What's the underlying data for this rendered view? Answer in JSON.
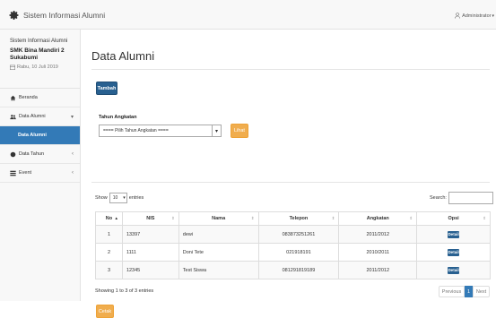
{
  "header": {
    "brand": "Sistem Informasi Alumni",
    "user": "Administrator"
  },
  "sidebar": {
    "app_name": "Sistem Informasi Alumni",
    "school": "SMK Bina Mandiri 2 Sukabumi",
    "date": "Rabu, 10 Juli 2019",
    "items": [
      {
        "label": "Beranda"
      },
      {
        "label": "Data Alumni"
      },
      {
        "label": "Data Alumni"
      },
      {
        "label": "Data Tahun"
      },
      {
        "label": "Event"
      }
    ]
  },
  "main": {
    "title": "Data Alumni",
    "add_button": "Tambah",
    "filter_label": "Tahun Angkatan",
    "filter_value": "==== Pilih Tahun Angkatan ====",
    "view_button": "Lihat",
    "show_label": "Show",
    "entries_value": "10",
    "entries_label": "entries",
    "search_label": "Search:",
    "table": {
      "columns": [
        "No",
        "NIS",
        "Nama",
        "Telepon",
        "Angkatan",
        "Opsi"
      ],
      "rows": [
        [
          "1",
          "13397",
          "dewi",
          "083873251261",
          "2011/2012",
          "Detail"
        ],
        [
          "2",
          "1111",
          "Doni Tete",
          "021918191",
          "2010/2011",
          "Detail"
        ],
        [
          "3",
          "12345",
          "Test Siswa",
          "081291819189",
          "2011/2012",
          "Detail"
        ]
      ]
    },
    "info": "Showing 1 to 3 of 3 entries",
    "pager": {
      "prev": "Previous",
      "page": "1",
      "next": "Next"
    },
    "print_button": "Cetak"
  }
}
